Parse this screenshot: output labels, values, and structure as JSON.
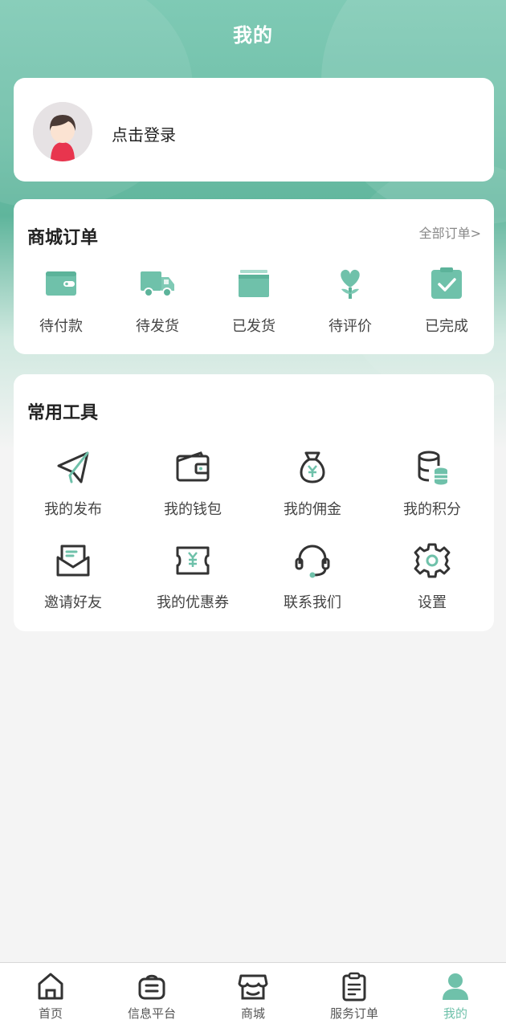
{
  "header": {
    "title": "我的"
  },
  "user": {
    "login_prompt": "点击登录"
  },
  "orders": {
    "title": "商城订单",
    "all_link": "全部订单>",
    "items": [
      {
        "label": "待付款",
        "icon": "wallet-icon"
      },
      {
        "label": "待发货",
        "icon": "truck-icon"
      },
      {
        "label": "已发货",
        "icon": "box-icon"
      },
      {
        "label": "待评价",
        "icon": "heart-flower-icon"
      },
      {
        "label": "已完成",
        "icon": "clipboard-check-icon"
      }
    ]
  },
  "tools": {
    "title": "常用工具",
    "items": [
      {
        "label": "我的发布",
        "icon": "paper-plane-icon"
      },
      {
        "label": "我的钱包",
        "icon": "wallet-outline-icon"
      },
      {
        "label": "我的佣金",
        "icon": "money-bag-icon"
      },
      {
        "label": "我的积分",
        "icon": "coins-database-icon"
      },
      {
        "label": "邀请好友",
        "icon": "envelope-icon"
      },
      {
        "label": "我的优惠券",
        "icon": "coupon-icon"
      },
      {
        "label": "联系我们",
        "icon": "headset-icon"
      },
      {
        "label": "设置",
        "icon": "gear-icon"
      }
    ]
  },
  "tabbar": {
    "items": [
      {
        "label": "首页",
        "icon": "home-icon"
      },
      {
        "label": "信息平台",
        "icon": "list-bag-icon"
      },
      {
        "label": "商城",
        "icon": "store-icon"
      },
      {
        "label": "服务订单",
        "icon": "clipboard-icon"
      },
      {
        "label": "我的",
        "icon": "person-icon",
        "active": true
      }
    ]
  },
  "colors": {
    "accent": "#6fc1aa",
    "accent_dark": "#5cb39a",
    "icon_stroke": "#333333"
  }
}
